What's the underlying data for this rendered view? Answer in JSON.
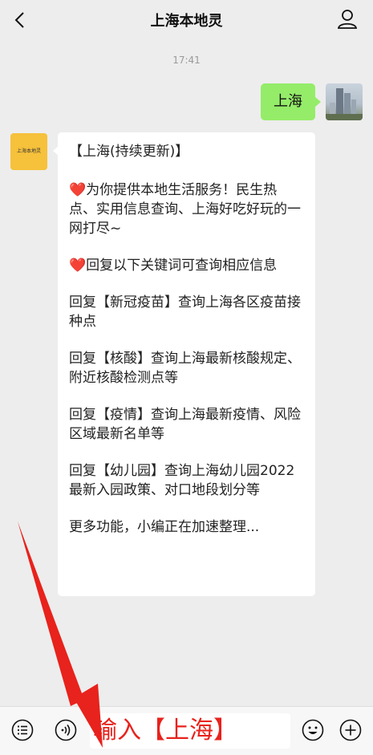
{
  "header": {
    "title": "上海本地灵",
    "back_icon": "chevron-left-icon",
    "profile_icon": "person-icon"
  },
  "chat": {
    "time": "17:41",
    "outgoing": {
      "text": "上海",
      "bubble_color": "#95ec69"
    },
    "incoming": {
      "avatar_text": "上海本地灵",
      "avatar_color": "#f6c13b",
      "paragraphs": [
        "【上海(持续更新)】",
        "为你提供本地生活服务！民生热点、实用信息查询、上海好吃好玩的一网打尽~",
        "回复以下关键词可查询相应信息",
        "回复【新冠疫苗】查询上海各区疫苗接种点",
        "回复【核酸】查询上海最新核酸规定、附近核酸检测点等",
        "回复【疫情】查询上海最新疫情、风险区域最新名单等",
        "回复【幼儿园】查询上海幼儿园2022最新入园政策、对口地段划分等",
        "更多功能，小编正在加速整理..."
      ],
      "heart": "❤️"
    }
  },
  "bottom_bar": {
    "input_text": "输入【上海】",
    "annotation_color": "#e8221c",
    "icons": [
      "menu-list-icon",
      "voice-icon",
      "emoji-icon",
      "plus-icon"
    ]
  }
}
